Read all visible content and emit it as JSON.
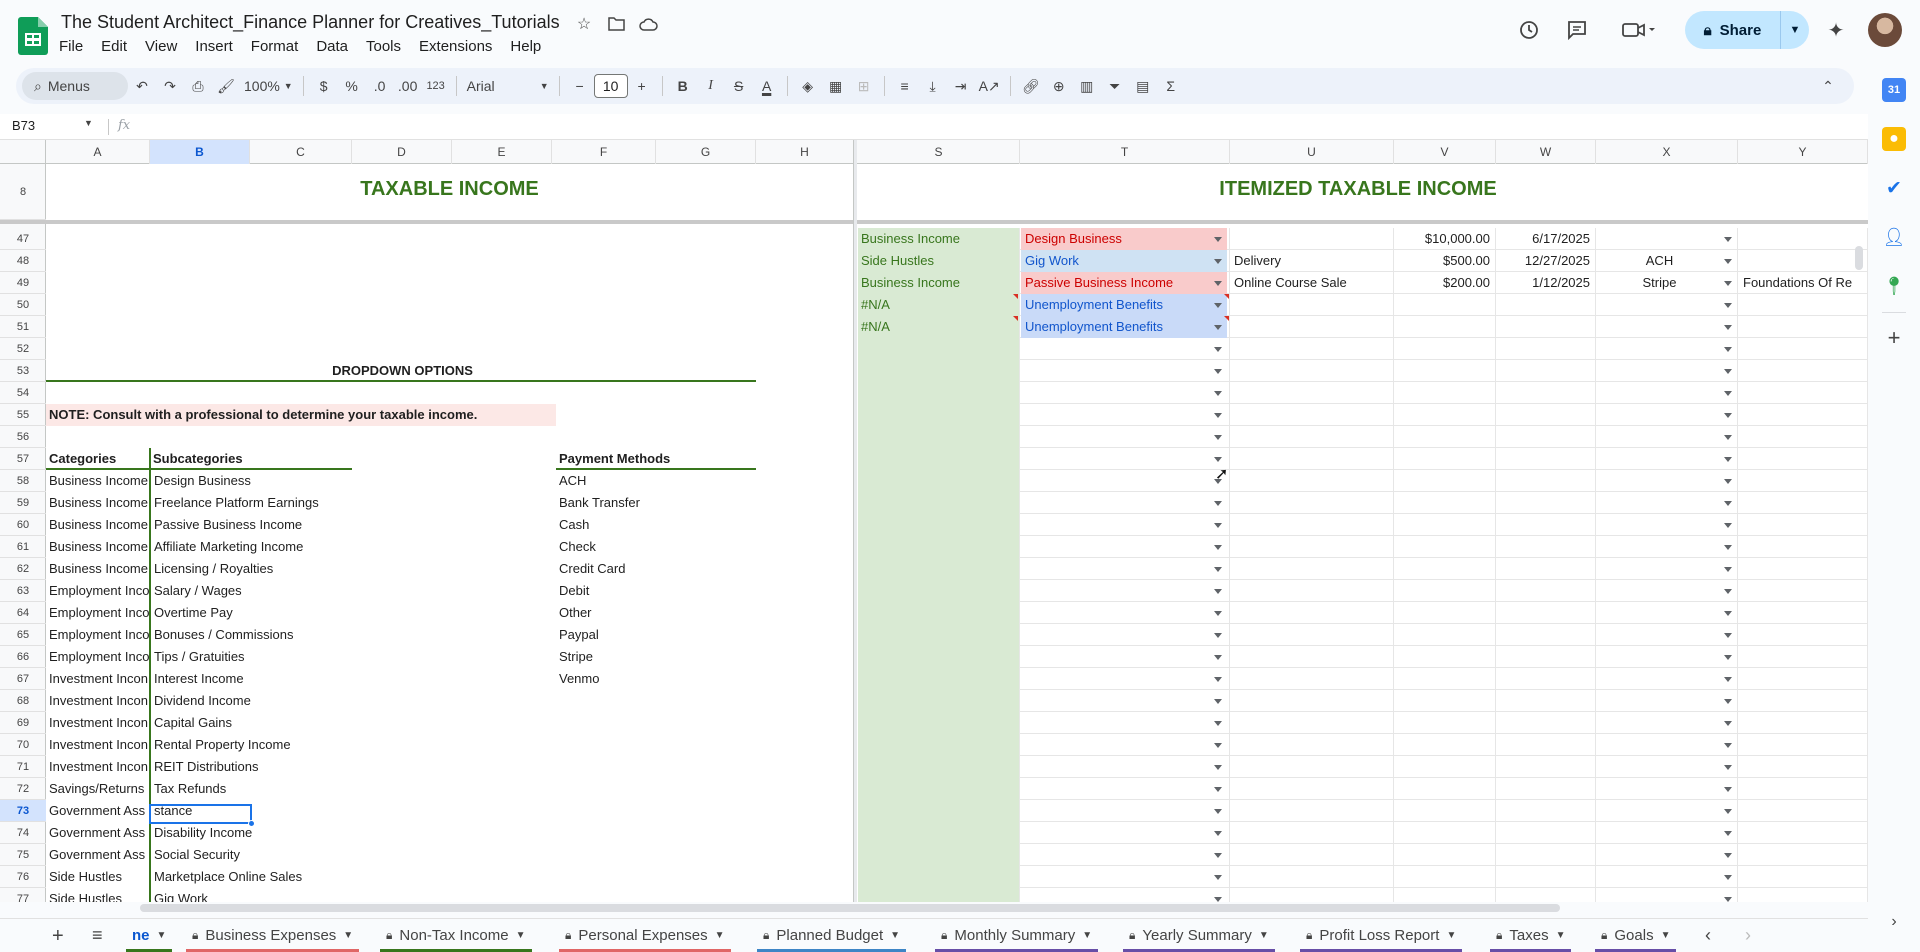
{
  "app": {
    "title": "The Student Architect_Finance Planner for Creatives_Tutorials",
    "menu": [
      "File",
      "Edit",
      "View",
      "Insert",
      "Format",
      "Data",
      "Tools",
      "Extensions",
      "Help"
    ],
    "share_label": "Share"
  },
  "toolbar": {
    "menus_label": "Menus",
    "zoom": "100%",
    "currency": "$",
    "percent": "%",
    "dec_dec": ".0",
    "dec_inc": ".00",
    "number_fmt": "123",
    "font": "Arial",
    "font_size": "10"
  },
  "formula": {
    "cell_ref": "B73",
    "fx": "fx"
  },
  "columns_left": [
    "A",
    "B",
    "C",
    "D",
    "E",
    "F",
    "G",
    "H"
  ],
  "columns_right": [
    "S",
    "T",
    "U",
    "V",
    "W",
    "X",
    "Y"
  ],
  "rows": [
    "8",
    "47",
    "48",
    "49",
    "50",
    "51",
    "52",
    "53",
    "54",
    "55",
    "56",
    "57",
    "58",
    "59",
    "60",
    "61",
    "62",
    "63",
    "64",
    "65",
    "66",
    "67",
    "68",
    "69",
    "70",
    "71",
    "72",
    "73",
    "74",
    "75",
    "76",
    "77"
  ],
  "sections": {
    "left_title": "TAXABLE INCOME",
    "right_title": "ITEMIZED TAXABLE INCOME"
  },
  "dropdown_options": {
    "heading": "DROPDOWN OPTIONS",
    "note": "NOTE: Consult with a professional to determine your taxable income.",
    "categories_header": "Categories",
    "subcategories_header": "Subcategories",
    "payment_header": "Payment Methods",
    "categories": [
      "Business Income",
      "Business Income",
      "Business Income",
      "Business Income",
      "Business Income",
      "Employment Inco",
      "Employment Inco",
      "Employment Inco",
      "Employment Inco",
      "Investment Incon",
      "Investment Incon",
      "Investment Incon",
      "Investment Incon",
      "Investment Incon",
      "Savings/Returns",
      "Government Ass",
      "Government Ass",
      "Government Ass",
      "Side Hustles",
      "Side Hustles"
    ],
    "subcategories": [
      "Design Business",
      "Freelance Platform Earnings",
      "Passive Business Income",
      "Affiliate Marketing Income",
      "Licensing / Royalties",
      "Salary / Wages",
      "Overtime Pay",
      "Bonuses / Commissions",
      "Tips / Gratuities",
      "Interest Income",
      "Dividend Income",
      "Capital Gains",
      "Rental Property Income",
      "REIT Distributions",
      "Tax Refunds",
      "stance",
      "Disability Income",
      "Social Security",
      "Marketplace Online Sales",
      "Gig Work"
    ],
    "payment_methods": [
      "ACH",
      "Bank Transfer",
      "Cash",
      "Check",
      "Credit Card",
      "Debit",
      "Other",
      "Paypal",
      "Stripe",
      "Venmo"
    ]
  },
  "itemized_rows": [
    {
      "category": "Business Income",
      "subcategory": "Design Business",
      "description": "",
      "amount": "$10,000.00",
      "date": "6/17/2025",
      "method": "",
      "extra": ""
    },
    {
      "category": "Side Hustles",
      "subcategory": "Gig Work",
      "description": "Delivery",
      "amount": "$500.00",
      "date": "12/27/2025",
      "method": "ACH",
      "extra": ""
    },
    {
      "category": "Business Income",
      "subcategory": "Passive Business Income",
      "description": "Online Course Sale",
      "amount": "$200.00",
      "date": "1/12/2025",
      "method": "Stripe",
      "extra": "Foundations Of Re"
    },
    {
      "category": "#N/A",
      "subcategory": "Unemployment Benefits",
      "description": "",
      "amount": "",
      "date": "",
      "method": "",
      "extra": ""
    },
    {
      "category": "#N/A",
      "subcategory": "Unemployment Benefits",
      "description": "",
      "amount": "",
      "date": "",
      "method": "",
      "extra": ""
    }
  ],
  "sheet_tabs": [
    {
      "label": "ne",
      "locked": false,
      "color": "#38761d",
      "active": true
    },
    {
      "label": "Business Expenses",
      "locked": true,
      "color": "#e06666"
    },
    {
      "label": "Non-Tax Income",
      "locked": true,
      "color": "#38761d"
    },
    {
      "label": "Personal Expenses",
      "locked": true,
      "color": "#e06666"
    },
    {
      "label": "Planned Budget",
      "locked": true,
      "color": "#3d85c6"
    },
    {
      "label": "Monthly Summary",
      "locked": true,
      "color": "#674ea7"
    },
    {
      "label": "Yearly Summary",
      "locked": true,
      "color": "#674ea7"
    },
    {
      "label": "Profit Loss Report",
      "locked": true,
      "color": "#674ea7"
    },
    {
      "label": "Taxes",
      "locked": true,
      "color": "#674ea7"
    },
    {
      "label": "Goals",
      "locked": true,
      "color": "#674ea7"
    }
  ],
  "colors": {
    "accent_green": "#38761d",
    "fill_green": "#d9ead3",
    "chip_red_bg": "#f9cbcb",
    "chip_red_text": "#cc0000",
    "chip_blue_bg": "#c9daf8",
    "chip_blue_text": "#1155cc",
    "chip_gray_bg": "#cfe2f3"
  }
}
